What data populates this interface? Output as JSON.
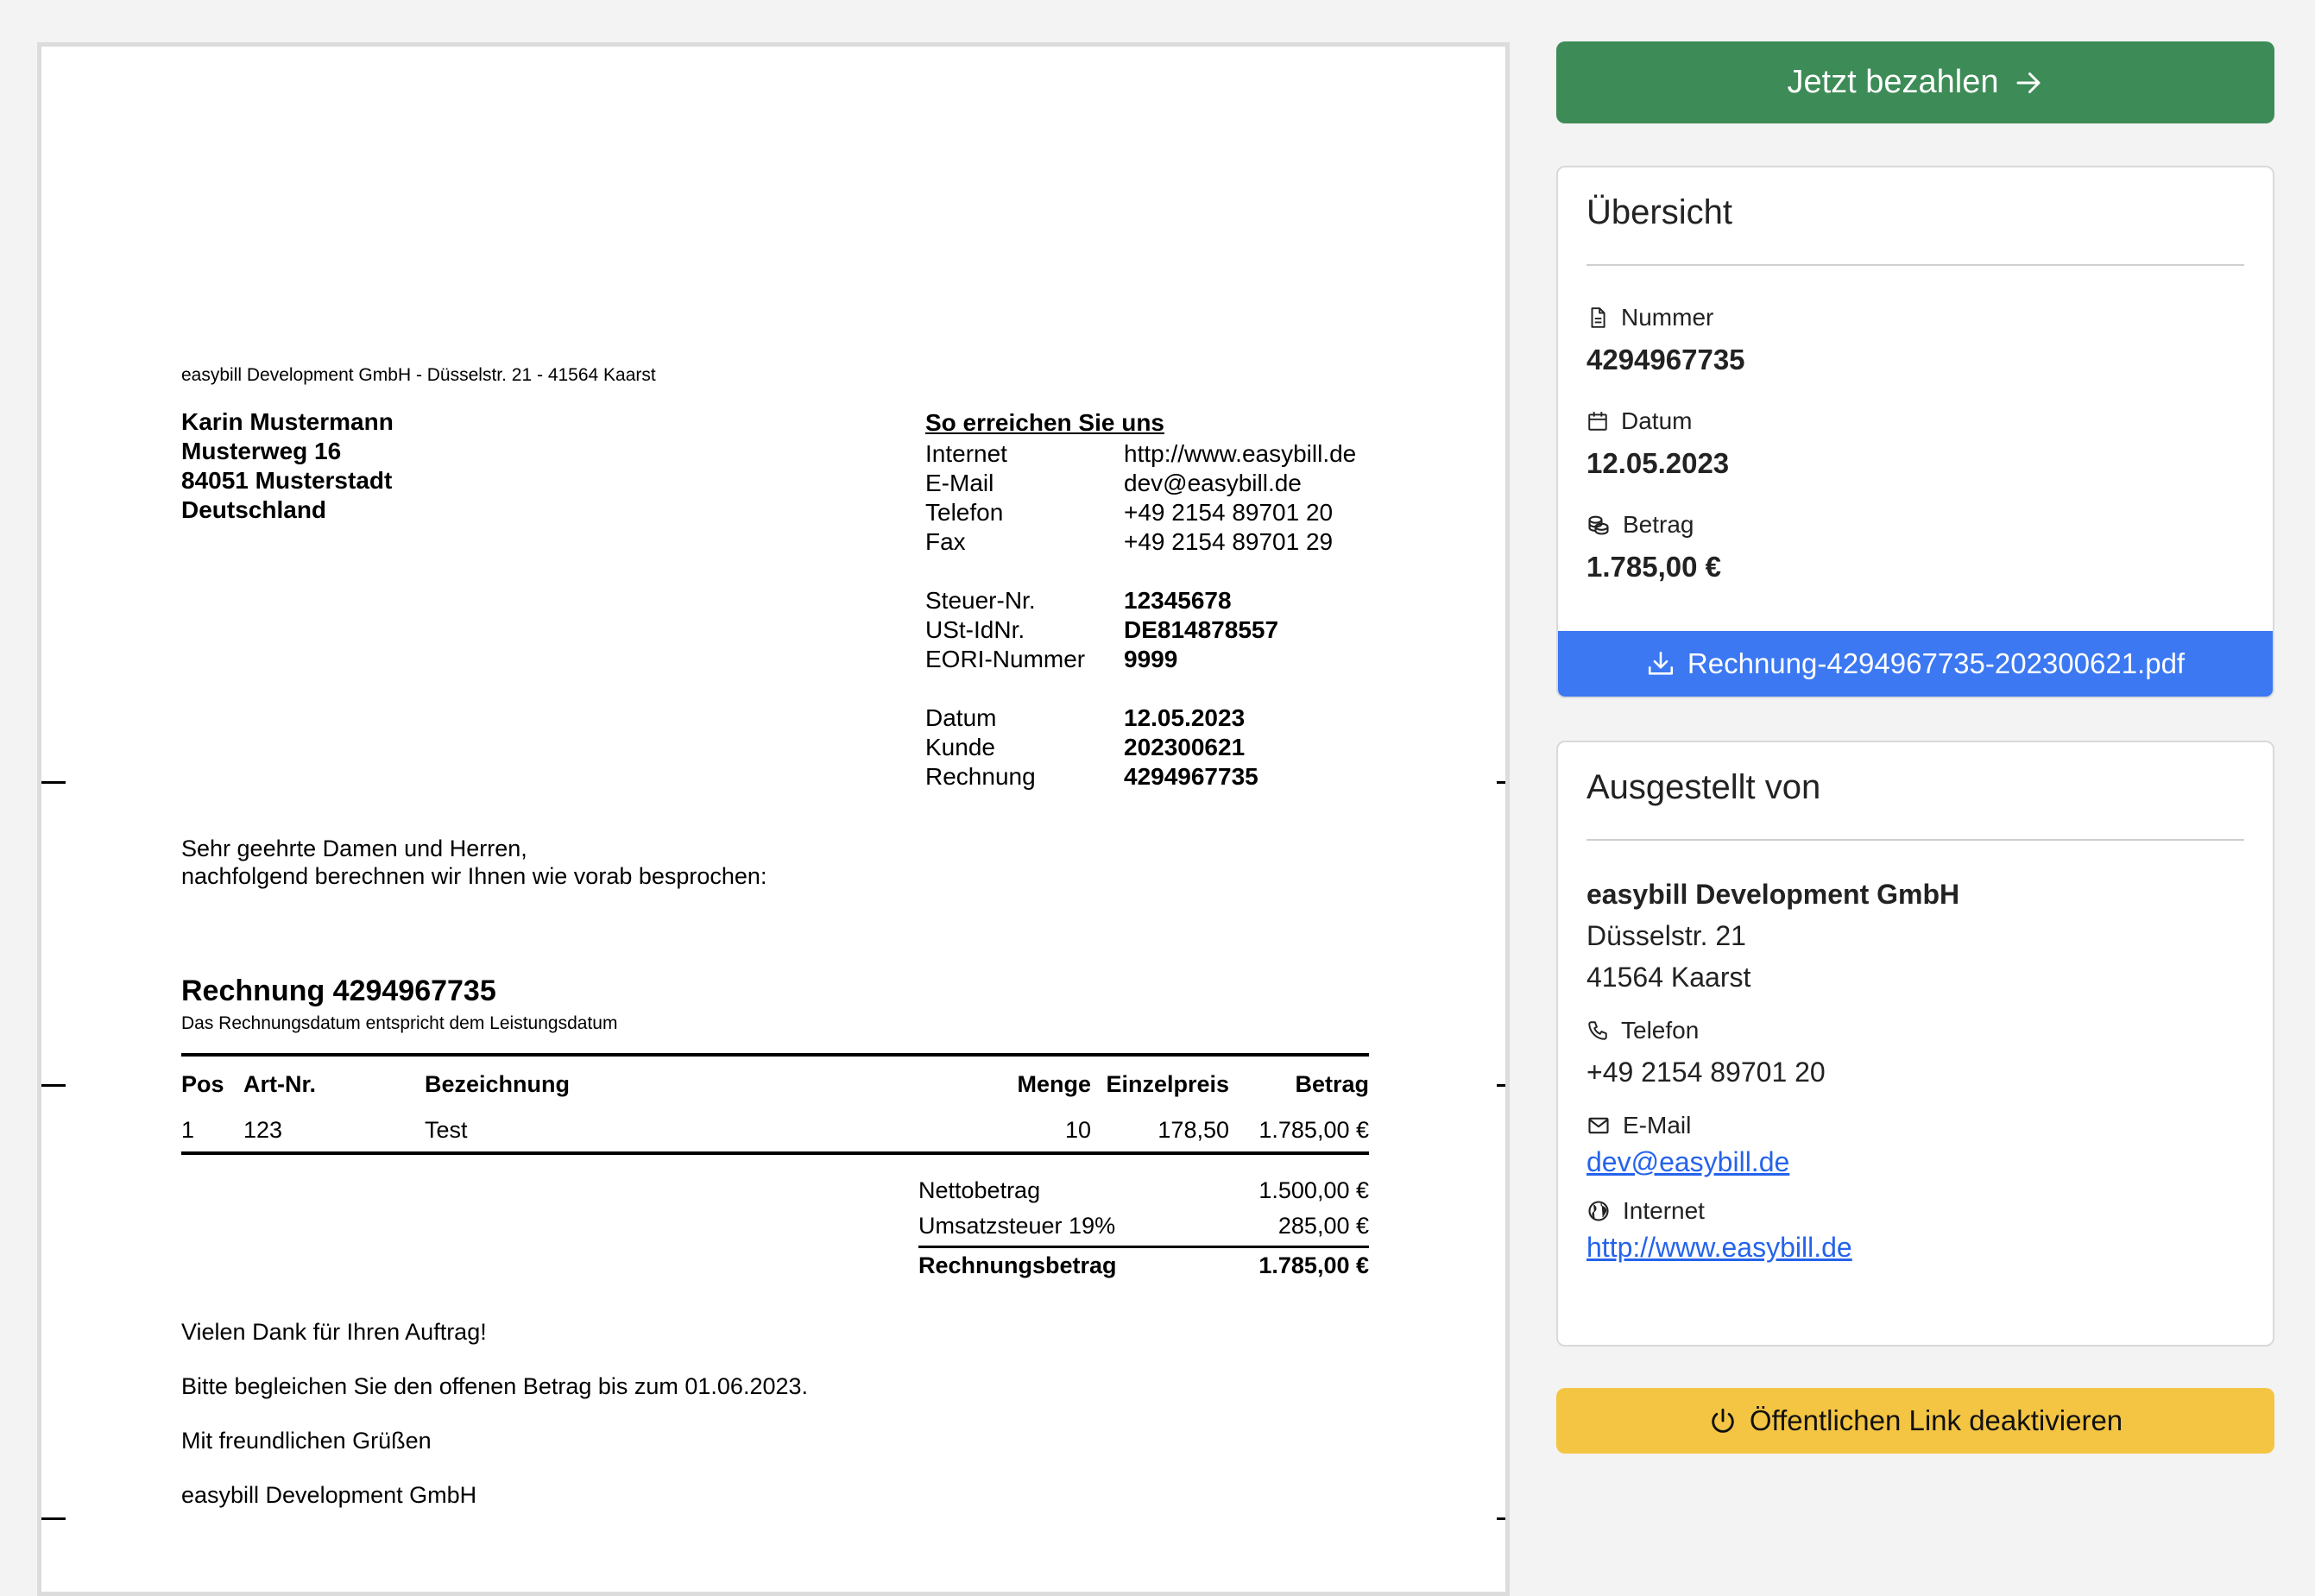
{
  "invoice": {
    "sender_line": "easybill Development GmbH - Düsselstr. 21 - 41564 Kaarst",
    "recipient": [
      "Karin Mustermann",
      "Musterweg 16",
      "84051 Musterstadt",
      "Deutschland"
    ],
    "contact_header": "So erreichen Sie uns",
    "contact": [
      {
        "label": "Internet",
        "value": "http://www.easybill.de"
      },
      {
        "label": "E-Mail",
        "value": "dev@easybill.de"
      },
      {
        "label": "Telefon",
        "value": "+49 2154 89701 20"
      },
      {
        "label": "Fax",
        "value": "+49 2154 89701 29"
      }
    ],
    "tax": [
      {
        "label": "Steuer-Nr.",
        "value": "12345678"
      },
      {
        "label": "USt-IdNr.",
        "value": "DE814878557"
      },
      {
        "label": "EORI-Nummer",
        "value": "9999"
      }
    ],
    "meta": [
      {
        "label": "Datum",
        "value": "12.05.2023"
      },
      {
        "label": "Kunde",
        "value": "202300621"
      },
      {
        "label": "Rechnung",
        "value": "4294967735"
      }
    ],
    "greeting": [
      "Sehr geehrte Damen und Herren,",
      "nachfolgend berechnen wir Ihnen wie vorab besprochen:"
    ],
    "title": "Rechnung 4294967735",
    "subtitle": "Das Rechnungsdatum entspricht dem Leistungsdatum",
    "columns": {
      "pos": "Pos",
      "art": "Art-Nr.",
      "bez": "Bezeichnung",
      "menge": "Menge",
      "einzel": "Einzelpreis",
      "betrag": "Betrag"
    },
    "items": [
      {
        "pos": "1",
        "art": "123",
        "bez": "Test",
        "menge": "10",
        "einzel": "178,50",
        "betrag": "1.785,00 €"
      }
    ],
    "sums": {
      "netto_label": "Nettobetrag",
      "netto": "1.500,00 €",
      "ust_label": "Umsatzsteuer 19%",
      "ust": "285,00 €",
      "total_label": "Rechnungsbetrag",
      "total": "1.785,00 €"
    },
    "closing": [
      "Vielen Dank für Ihren Auftrag!",
      "Bitte begleichen Sie den offenen Betrag bis zum 01.06.2023.",
      "Mit freundlichen Grüßen",
      "easybill Development GmbH"
    ]
  },
  "pay_button": "Jetzt bezahlen",
  "overview": {
    "title": "Übersicht",
    "number_label": "Nummer",
    "number": "4294967735",
    "date_label": "Datum",
    "date": "12.05.2023",
    "amount_label": "Betrag",
    "amount": "1.785,00 €",
    "download": "Rechnung-4294967735-202300621.pdf"
  },
  "issuer": {
    "title": "Ausgestellt von",
    "company": "easybill Development GmbH",
    "street": "Düsselstr. 21",
    "city": "41564 Kaarst",
    "phone_label": "Telefon",
    "phone": "+49 2154 89701 20",
    "email_label": "E-Mail",
    "email": "dev@easybill.de",
    "internet_label": "Internet",
    "internet": "http://www.easybill.de"
  },
  "deactivate_button": "Öffentlichen Link deaktivieren",
  "colors": {
    "pay": "#3d8b56",
    "download": "#3b78f2",
    "deactivate": "#f4c543",
    "link": "#2563eb"
  }
}
